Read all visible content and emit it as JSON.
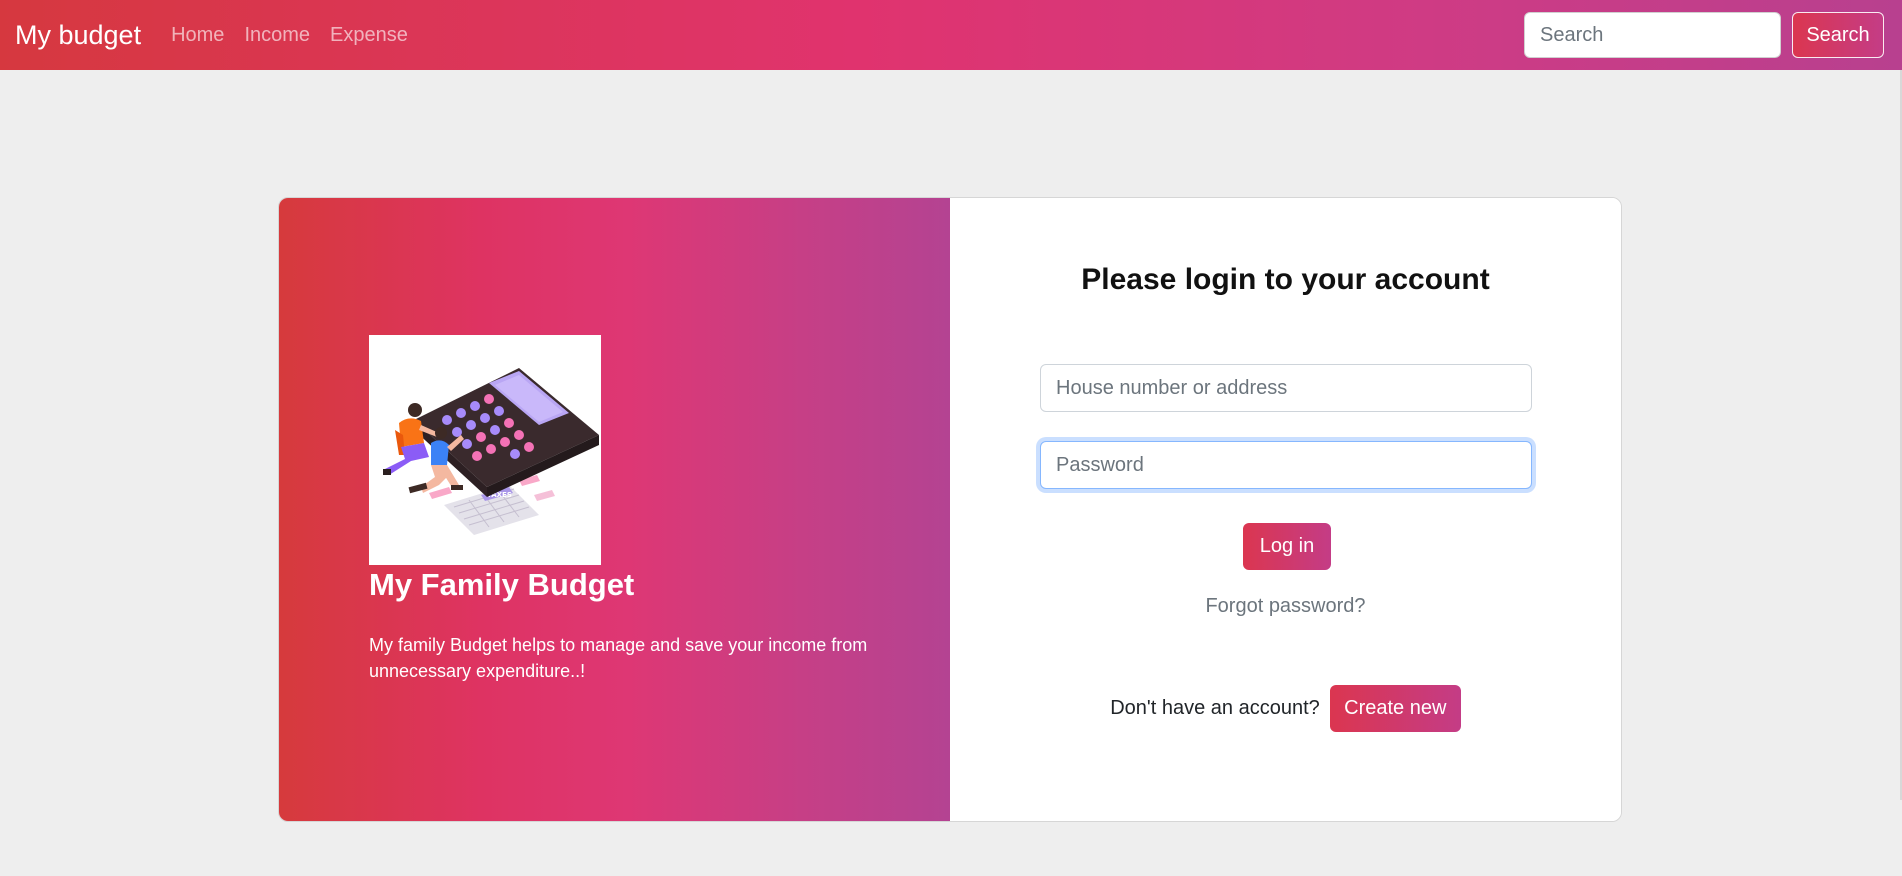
{
  "navbar": {
    "brand": "My budget",
    "links": [
      "Home",
      "Income",
      "Expense"
    ],
    "search_placeholder": "Search",
    "search_button": "Search"
  },
  "hero": {
    "title": "My Family Budget",
    "description": "My family Budget helps to manage and save your income from unnecessary expenditure..!",
    "illustration_tag": "TAXES"
  },
  "login": {
    "heading": "Please login to your account",
    "username_placeholder": "House number or address",
    "password_placeholder": "Password",
    "login_button": "Log in",
    "forgot_link": "Forgot password?",
    "signup_prompt": "Don't have an account?",
    "signup_button": "Create new"
  },
  "colors": {
    "gradient_start": "#d6383f",
    "gradient_mid": "#e0336e",
    "gradient_end": "#b8408f",
    "page_background": "#eeeeee"
  }
}
